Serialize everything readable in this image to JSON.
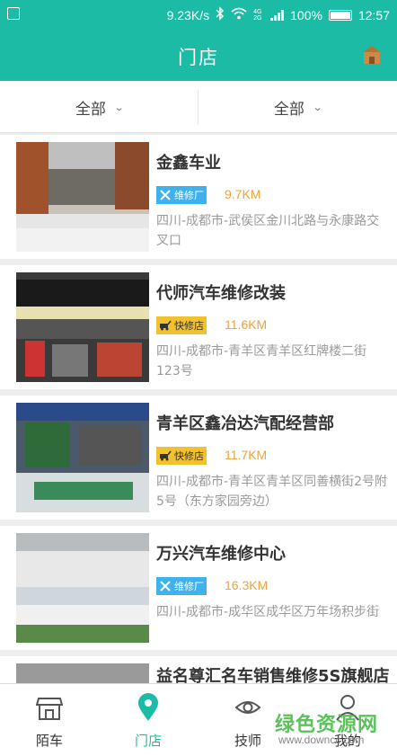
{
  "status_bar": {
    "speed": "9.23K/s",
    "network_badge": "4G 2G",
    "battery": "100%",
    "time": "12:57"
  },
  "header": {
    "title": "门店",
    "right_icon": "store-icon"
  },
  "filters": [
    {
      "label": "全部"
    },
    {
      "label": "全部"
    }
  ],
  "stores": [
    {
      "name": "金鑫车业",
      "tag": "维修厂",
      "tag_type": "repair",
      "distance": "9.7KM",
      "address": "四川-成都市-武侯区金川北路与永康路交叉口"
    },
    {
      "name": "代师汽车维修改装",
      "tag": "快修店",
      "tag_type": "quick",
      "distance": "11.6KM",
      "address": "四川-成都市-青羊区青羊区红牌楼二街123号"
    },
    {
      "name": "青羊区鑫冶达汽配经营部",
      "tag": "快修店",
      "tag_type": "quick",
      "distance": "11.7KM",
      "address": "四川-成都市-青羊区青羊区同善横街2号附5号（东方家园旁边）"
    },
    {
      "name": "万兴汽车维修中心",
      "tag": "维修厂",
      "tag_type": "repair",
      "distance": "16.3KM",
      "address": "四川-成都市-成华区成华区万年场积步街"
    },
    {
      "name": "益名尊汇名车销售维修5S旗舰店",
      "tag": "",
      "tag_type": "",
      "distance": "",
      "address": ""
    }
  ],
  "bottom_nav": [
    {
      "label": "陌车",
      "icon": "shop-icon"
    },
    {
      "label": "门店",
      "icon": "location-pin-icon",
      "active": true
    },
    {
      "label": "技师",
      "icon": "eye-icon"
    },
    {
      "label": "我的",
      "icon": "person-icon"
    }
  ],
  "watermark": {
    "text": "绿色资源网",
    "url": "www.downcc.com"
  },
  "colors": {
    "primary": "#1cbba6",
    "distance": "#f0a23a",
    "repair_tag": "#3fb2ed",
    "quick_tag": "#f2c12e"
  }
}
